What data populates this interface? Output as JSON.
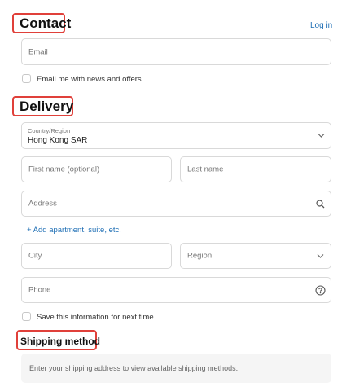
{
  "contact": {
    "title": "Contact",
    "login_link": "Log in",
    "email_placeholder": "Email",
    "news_checkbox_label": "Email me with news and offers",
    "news_checked": false
  },
  "delivery": {
    "title": "Delivery",
    "country_label": "Country/Region",
    "country_value": "Hong Kong SAR",
    "first_name_placeholder": "First name (optional)",
    "last_name_placeholder": "Last name",
    "address_placeholder": "Address",
    "add_apartment_link": "+ Add apartment, suite, etc.",
    "city_placeholder": "City",
    "region_placeholder": "Region",
    "phone_placeholder": "Phone",
    "save_checkbox_label": "Save this information for next time",
    "save_checked": false
  },
  "shipping": {
    "title": "Shipping method",
    "notice": "Enter your shipping address to view available shipping methods."
  },
  "icons": {
    "search": "search-icon",
    "help": "help-circle-icon",
    "chevron": "chevron-down-icon"
  },
  "colors": {
    "highlight": "#e0403a",
    "link": "#1f6fb5",
    "border": "#d9d9d9"
  }
}
